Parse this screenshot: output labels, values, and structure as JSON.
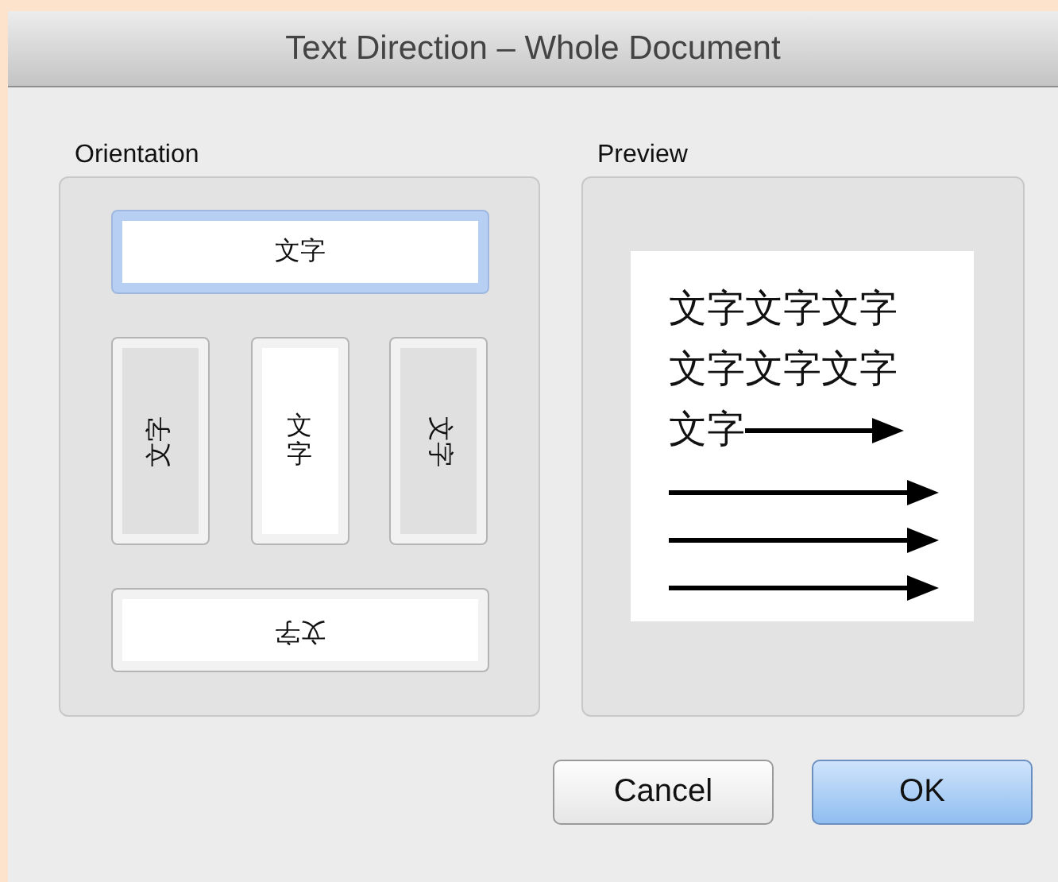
{
  "window": {
    "title": "Text Direction – Whole Document"
  },
  "orientation": {
    "label": "Orientation",
    "options": [
      {
        "kind": "horizontal",
        "text": "文字",
        "selected": true
      },
      {
        "kind": "rotate-left",
        "text": "文字",
        "selected": false
      },
      {
        "kind": "stacked",
        "text": "文字",
        "selected": false
      },
      {
        "kind": "rotate-right",
        "text": "文字",
        "selected": false
      },
      {
        "kind": "upside-down",
        "text": "文字",
        "selected": false
      }
    ]
  },
  "preview": {
    "label": "Preview",
    "lines": [
      "文字文字文字",
      "文字文字文字",
      "文字"
    ]
  },
  "buttons": [
    {
      "label": "Cancel",
      "default": false
    },
    {
      "label": "OK",
      "default": true
    }
  ]
}
